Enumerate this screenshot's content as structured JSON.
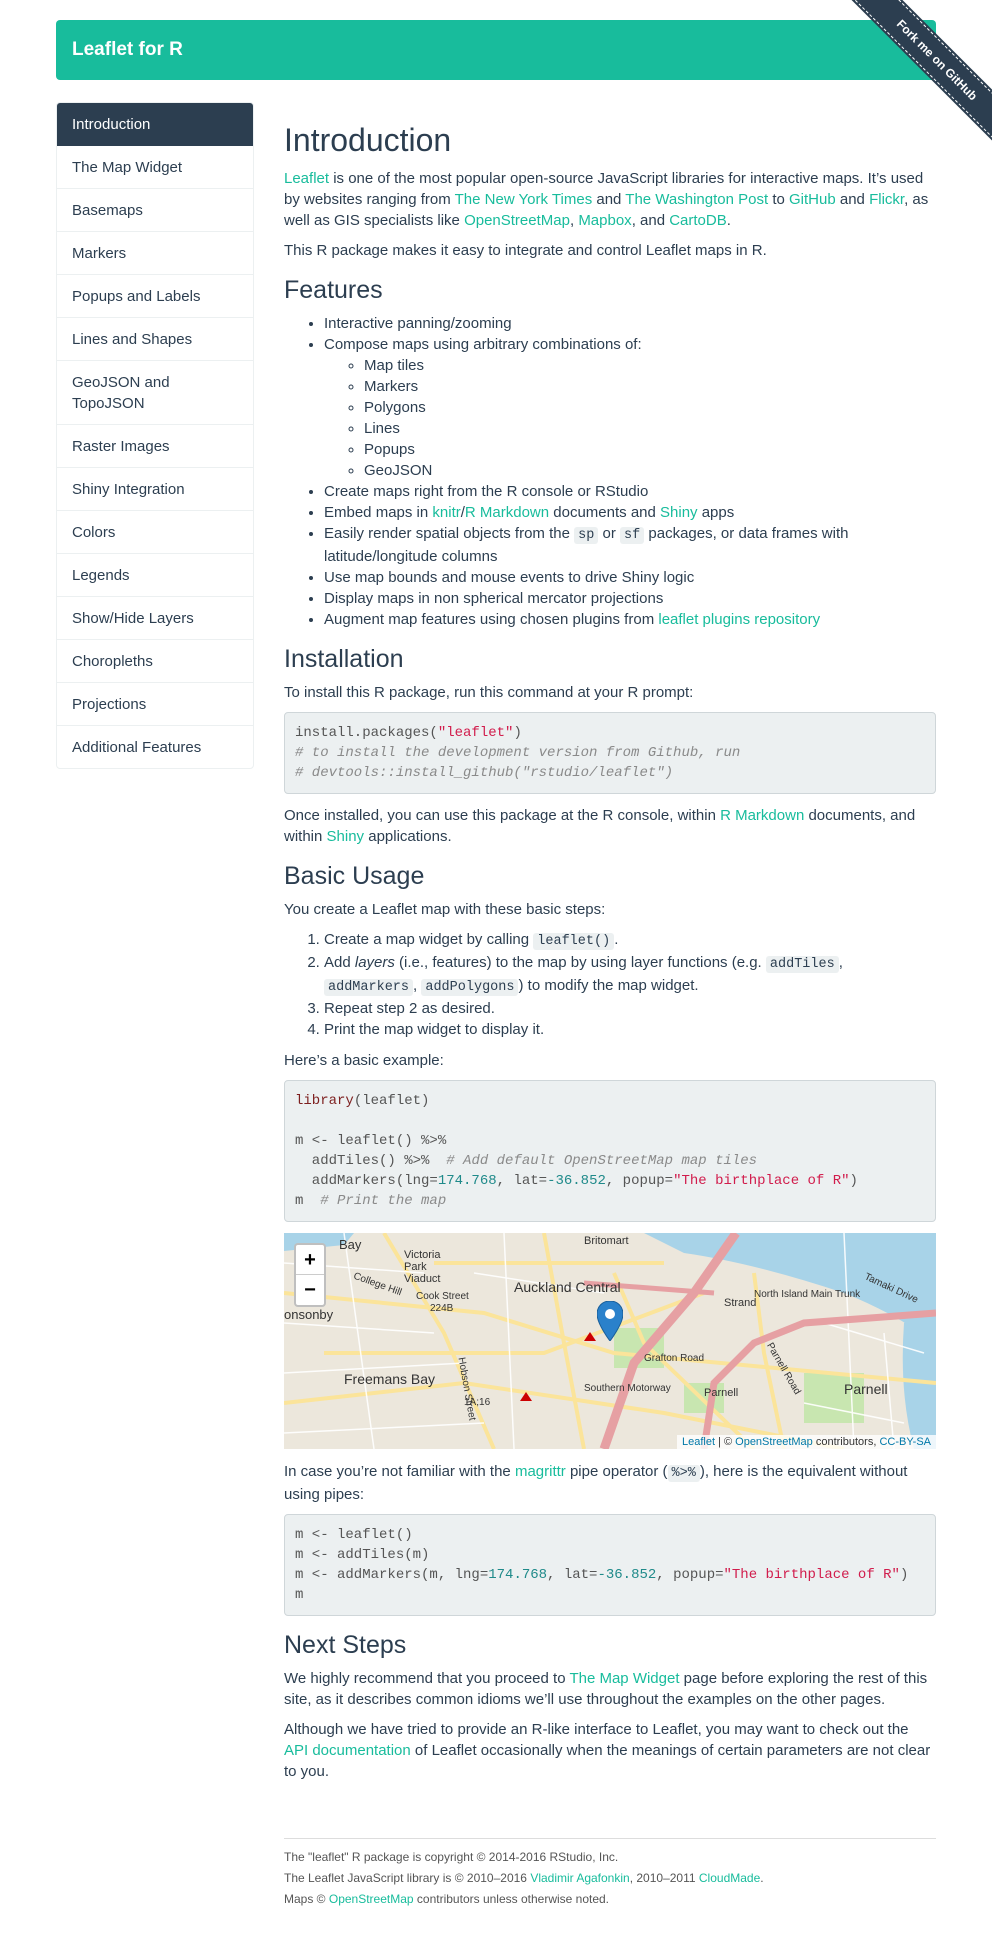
{
  "navbar": {
    "brand": "Leaflet for R"
  },
  "ribbon": {
    "label": "Fork me on GitHub"
  },
  "sidebar": {
    "items": [
      {
        "label": "Introduction"
      },
      {
        "label": "The Map Widget"
      },
      {
        "label": "Basemaps"
      },
      {
        "label": "Markers"
      },
      {
        "label": "Popups and Labels"
      },
      {
        "label": "Lines and Shapes"
      },
      {
        "label": "GeoJSON and TopoJSON"
      },
      {
        "label": "Raster Images"
      },
      {
        "label": "Shiny Integration"
      },
      {
        "label": "Colors"
      },
      {
        "label": "Legends"
      },
      {
        "label": "Show/Hide Layers"
      },
      {
        "label": "Choropleths"
      },
      {
        "label": "Projections"
      },
      {
        "label": "Additional Features"
      }
    ]
  },
  "intro": {
    "title": "Introduction",
    "p1_link": "Leaflet",
    "p1_a": " is one of the most popular open-source JavaScript libraries for interactive maps. It’s used by websites ranging from ",
    "link_nyt": "The New York Times",
    "and1": " and ",
    "link_wp": "The Washington Post",
    "to": " to ",
    "link_gh": "GitHub",
    "and2": " and ",
    "link_flickr": "Flickr",
    "p1_b": ", as well as GIS specialists like ",
    "link_osm": "OpenStreetMap",
    "comma": ", ",
    "link_mapbox": "Mapbox",
    "and3": ", and ",
    "link_carto": "CartoDB",
    "period": ".",
    "p2": "This R package makes it easy to integrate and control Leaflet maps in R."
  },
  "features": {
    "title": "Features",
    "f1": "Interactive panning/zooming",
    "f2": "Compose maps using arbitrary combinations of:",
    "sub": [
      "Map tiles",
      "Markers",
      "Polygons",
      "Lines",
      "Popups",
      "GeoJSON"
    ],
    "f3": "Create maps right from the R console or RStudio",
    "f4_a": "Embed maps in ",
    "f4_knitr": "knitr",
    "f4_slash": "/",
    "f4_rmd": "R Markdown",
    "f4_b": " documents and ",
    "f4_shiny": "Shiny",
    "f4_c": " apps",
    "f5_a": "Easily render spatial objects from the ",
    "f5_sp": "sp",
    "f5_or": " or ",
    "f5_sf": "sf",
    "f5_b": " packages, or data frames with latitude/longitude columns",
    "f6": "Use map bounds and mouse events to drive Shiny logic",
    "f7": "Display maps in non spherical mercator projections",
    "f8_a": "Augment map features using chosen plugins from ",
    "f8_link": "leaflet plugins repository"
  },
  "install": {
    "title": "Installation",
    "p1": "To install this R package, run this command at your R prompt:",
    "code_l1_a": "install.packages(",
    "code_l1_str": "\"leaflet\"",
    "code_l1_b": ")",
    "code_l2": "# to install the development version from Github, run",
    "code_l3": "# devtools::install_github(\"rstudio/leaflet\")",
    "p2_a": "Once installed, you can use this package at the R console, within ",
    "p2_rmd": "R Markdown",
    "p2_b": " documents, and within ",
    "p2_shiny": "Shiny",
    "p2_c": " applications."
  },
  "usage": {
    "title": "Basic Usage",
    "p1": "You create a Leaflet map with these basic steps:",
    "s1_a": "Create a map widget by calling ",
    "s1_code": "leaflet()",
    "s1_b": ".",
    "s2_a": "Add ",
    "s2_em": "layers",
    "s2_b": " (i.e., features) to the map by using layer functions (e.g. ",
    "s2_c1": "addTiles",
    "s2_sep1": ", ",
    "s2_c2": "addMarkers",
    "s2_sep2": ", ",
    "s2_c3": "addPolygons",
    "s2_c": ") to modify the map widget.",
    "s3": "Repeat step 2 as desired.",
    "s4": "Print the map widget to display it.",
    "p2": "Here’s a basic example:",
    "ex_lib": "library",
    "ex_lib_arg": "(leaflet)",
    "ex_l2": "m <- leaflet() %>%",
    "ex_l3_a": "  addTiles() %>%  ",
    "ex_l3_cm": "# Add default OpenStreetMap map tiles",
    "ex_l4_a": "  addMarkers(lng=",
    "ex_l4_n1": "174.768",
    "ex_l4_b": ", lat=",
    "ex_l4_n2": "-36.852",
    "ex_l4_c": ", popup=",
    "ex_l4_str": "\"The birthplace of R\"",
    "ex_l4_d": ")",
    "ex_l5_a": "m  ",
    "ex_l5_cm": "# Print the map"
  },
  "map": {
    "zoom_in": "+",
    "zoom_out": "−",
    "labels": {
      "britomart": "Britomart",
      "victoria": "Victoria Park Viaduct",
      "auckland": "Auckland Central",
      "bay": "Bay",
      "college": "College Hill",
      "cook": "Cook Street",
      "onsonby": "onsonby",
      "freemans": "Freemans Bay",
      "strand": "Strand",
      "north_island": "North Island Main Trunk",
      "tamaki": "Tamaki Drive",
      "grafton": "Grafton Road",
      "southern": "Southern Motorway",
      "parnell": "Parnell",
      "parnell_big": "Parnell",
      "parnell_rd": "Parnell Road",
      "hobson": "Hobson Street",
      "r224": "224B",
      "r16": "1A;16"
    },
    "attrib_leaflet": "Leaflet",
    "attrib_sep": " | © ",
    "attrib_osm": "OpenStreetMap",
    "attrib_contrib": " contributors, ",
    "attrib_cc": "CC-BY-SA",
    "colors": {
      "water": "#a8d3e8",
      "land": "#ece7dc",
      "road_major": "#fbe49a",
      "motorway": "#e6a0a3",
      "marker": "#2a81cb",
      "park": "#c8e6b0"
    }
  },
  "nopipe": {
    "p_a": "In case you’re not familiar with the ",
    "p_link": "magrittr",
    "p_b": " pipe operator (",
    "p_code": "%>%",
    "p_c": "), here is the equivalent without using pipes:",
    "l1": "m <- leaflet()",
    "l2": "m <- addTiles(m)",
    "l3_a": "m <- addMarkers(m, lng=",
    "l3_n1": "174.768",
    "l3_b": ", lat=",
    "l3_n2": "-36.852",
    "l3_c": ", popup=",
    "l3_str": "\"The birthplace of R\"",
    "l3_d": ")",
    "l4": "m"
  },
  "next": {
    "title": "Next Steps",
    "p1_a": "We highly recommend that you proceed to ",
    "p1_link": "The Map Widget",
    "p1_b": " page before exploring the rest of this site, as it describes common idioms we’ll use throughout the examples on the other pages.",
    "p2_a": "Although we have tried to provide an R-like interface to Leaflet, you may want to check out the ",
    "p2_link": "API documentation",
    "p2_b": " of Leaflet occasionally when the meanings of certain parameters are not clear to you."
  },
  "footer": {
    "l1": "The \"leaflet\" R package is copyright © 2014-2016 RStudio, Inc.",
    "l2_a": "The Leaflet JavaScript library is © 2010–2016 ",
    "l2_link1": "Vladimir Agafonkin",
    "l2_b": ", 2010–2011 ",
    "l2_link2": "CloudMade",
    "l2_c": ".",
    "l3_a": "Maps © ",
    "l3_link": "OpenStreetMap",
    "l3_b": " contributors unless otherwise noted."
  }
}
